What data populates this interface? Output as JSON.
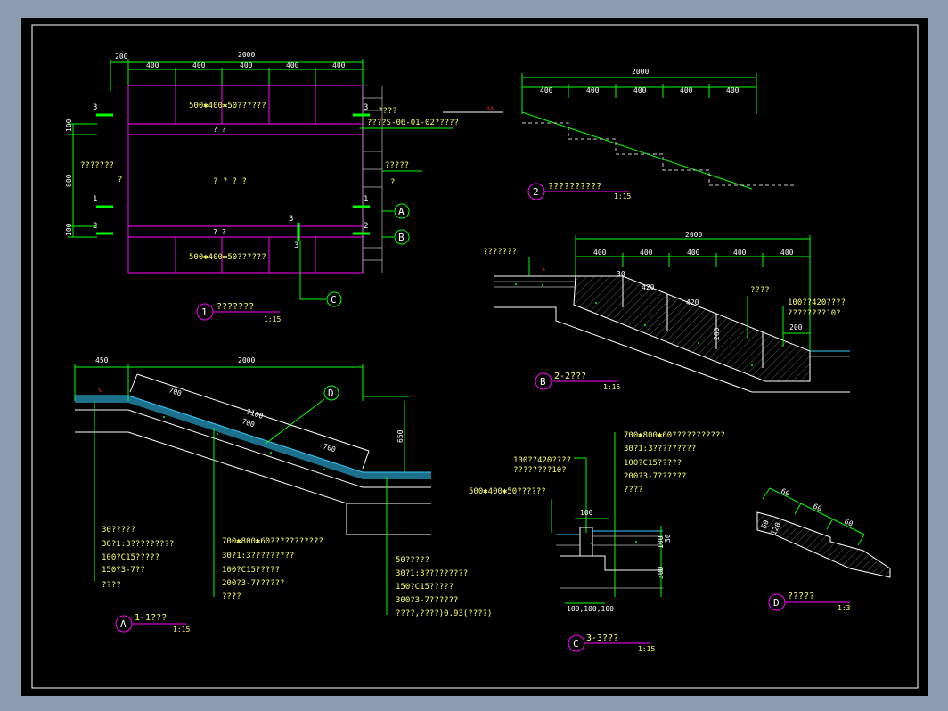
{
  "plan": {
    "dim_total": "2000",
    "dim_side": "200",
    "dims_400": [
      "400",
      "400",
      "400",
      "400",
      "400"
    ],
    "top_note": "500✱400✱50??????",
    "bottom_note": "500✱400✱50??????",
    "left_note": "???????",
    "left_dims": [
      "100",
      "800",
      "100"
    ],
    "right_note1": "????",
    "right_note2": "????S-06-01-02?????",
    "right_note3": "?????",
    "center_text": "? ? ? ?",
    "q1": "?",
    "q2": "?",
    "strip_top": "?  ?",
    "strip_bottom": "?  ?",
    "markers": [
      "3",
      "1",
      "2",
      "3",
      "1",
      "2",
      "3",
      "3"
    ],
    "slope_pct": "%",
    "title": "???????",
    "scale": "1:15",
    "num": "1",
    "callout_a": "A",
    "callout_b": "B",
    "callout_c": "C"
  },
  "view2": {
    "dim_total": "2000",
    "dims_400": [
      "400",
      "400",
      "400",
      "400",
      "400"
    ],
    "pct": "%",
    "title": "??????????",
    "scale": "1:15",
    "num": "2"
  },
  "sectionB": {
    "dim_total": "2000",
    "dims_400": [
      "400",
      "400",
      "400",
      "400",
      "400"
    ],
    "dim_30": "30",
    "dim_420a": "420",
    "dim_420b": "420",
    "dim_200": "200",
    "dim_200b": "200",
    "left_note": "???????",
    "right_note1": "????",
    "right_note2": "100??420????",
    "right_note3": "????????10?",
    "pct": "%",
    "title": "2-2???",
    "scale": "1:15",
    "num": "B"
  },
  "sectionA": {
    "dim_450": "450",
    "dim_2000": "2000",
    "dim_700a": "700",
    "dim_2100": "2100",
    "dim_700b": "700",
    "dim_700c": "700",
    "dim_650": "650",
    "pct": "%",
    "callout": "D",
    "layers_left": [
      "30?????",
      "30?1:3?????????",
      "100?C15?????",
      "150?3-7??",
      "????"
    ],
    "layers_mid": [
      "700✱800✱60???????????",
      "30?1:3?????????",
      "100?C15?????",
      "200?3-7??????",
      "????"
    ],
    "layers_right": [
      "50?????",
      "30?1:3?????????",
      "150?C15?????",
      "300?3-7??????",
      "????,????)0.93(????)"
    ],
    "title": "1-1???",
    "scale": "1:15",
    "num": "A"
  },
  "sectionC": {
    "layers": [
      "700✱800✱60???????????",
      "30?1:3?????????",
      "100?C15?????",
      "200?3-7??????",
      "????"
    ],
    "note1": "100??420????",
    "note2": "????????10?",
    "note3": "500✱400✱50??????",
    "dim_100": "100",
    "dim_30": "30",
    "dim_100v": "100",
    "dim_300": "300",
    "dims_bottom": "100,100,100",
    "title": "3-3???",
    "scale": "1:15",
    "num": "C"
  },
  "detailD": {
    "dims": [
      "60",
      "60",
      "60"
    ],
    "dim_a": "60",
    "dim_b": "120",
    "title": "?????",
    "scale": "1:3",
    "num": "D"
  },
  "colors": {
    "background": "#000000",
    "frame": "#8e9cb1",
    "magenta": "#ff00ff",
    "green": "#00ff00",
    "yellow": "#ffff66",
    "white": "#ffffff"
  }
}
